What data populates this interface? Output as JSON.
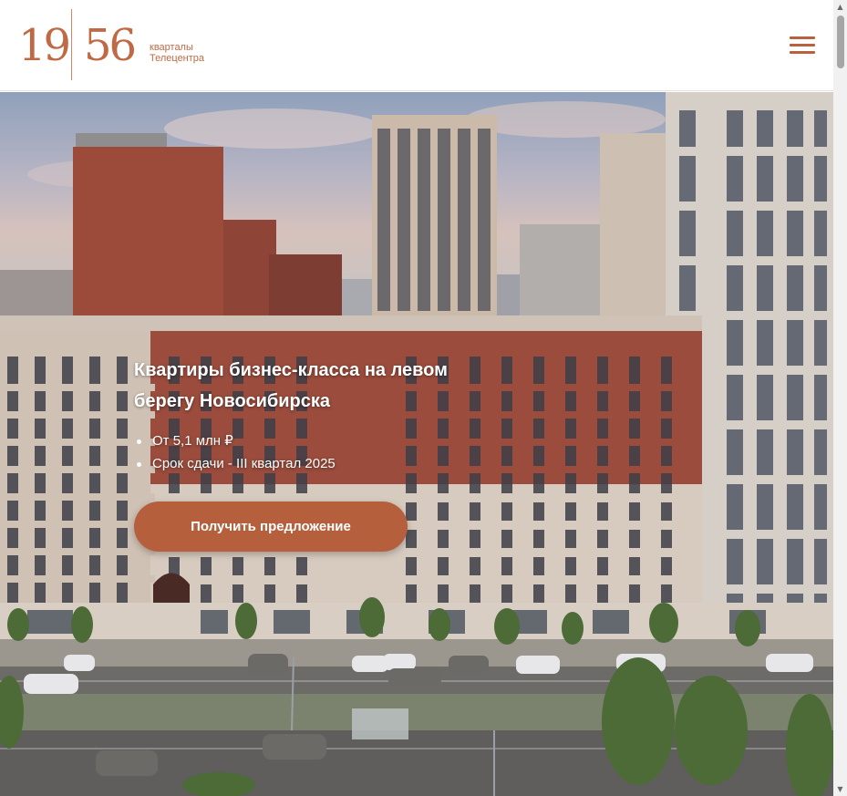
{
  "header": {
    "logo": {
      "left_number": "19",
      "right_number": "56",
      "tagline_line1": "кварталы",
      "tagline_line2": "Телецентра"
    },
    "menu_icon": "hamburger-menu-icon"
  },
  "hero": {
    "title_line1": "Квартиры бизнес-класса на левом",
    "title_line2": "берегу Новосибирска",
    "bullets": [
      "От 5,1 млн ₽",
      "Срок сдачи - III квартал 2025"
    ],
    "cta_label": "Получить предложение"
  },
  "colors": {
    "brand": "#c06a45",
    "cta": "#b55f3c",
    "text_on_hero": "#ffffff"
  }
}
